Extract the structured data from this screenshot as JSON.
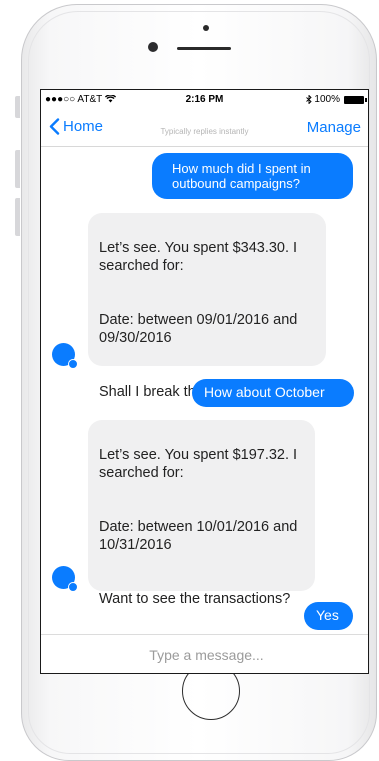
{
  "status_bar": {
    "carrier": "●●●○○ AT&T",
    "wifi_icon": "wifi-icon",
    "time": "2:16 PM",
    "bluetooth_icon": "bluetooth-icon",
    "battery": "100%"
  },
  "nav": {
    "back_label": "Home",
    "subtitle": "Typically replies instantly",
    "manage_label": "Manage"
  },
  "messages": [
    {
      "from": "user",
      "text": "How much did I spent in outbound campaigns?"
    },
    {
      "from": "bot",
      "lines": [
        "Let’s see. You spent $343.30. I searched for:",
        "Date: between 09/01/2016 and 09/30/2016",
        "Shall I break that down?"
      ]
    },
    {
      "from": "user",
      "text": "How about October"
    },
    {
      "from": "bot",
      "lines": [
        "Let’s see. You spent $197.32. I searched for:",
        "Date: between 10/01/2016 and 10/31/2016",
        "Want to see the transactions?"
      ]
    },
    {
      "from": "user",
      "text": "Yes"
    }
  ],
  "composer": {
    "placeholder": "Type a message..."
  },
  "colors": {
    "accent": "#0a7cff",
    "incoming_bubble": "#f0f0f1"
  }
}
